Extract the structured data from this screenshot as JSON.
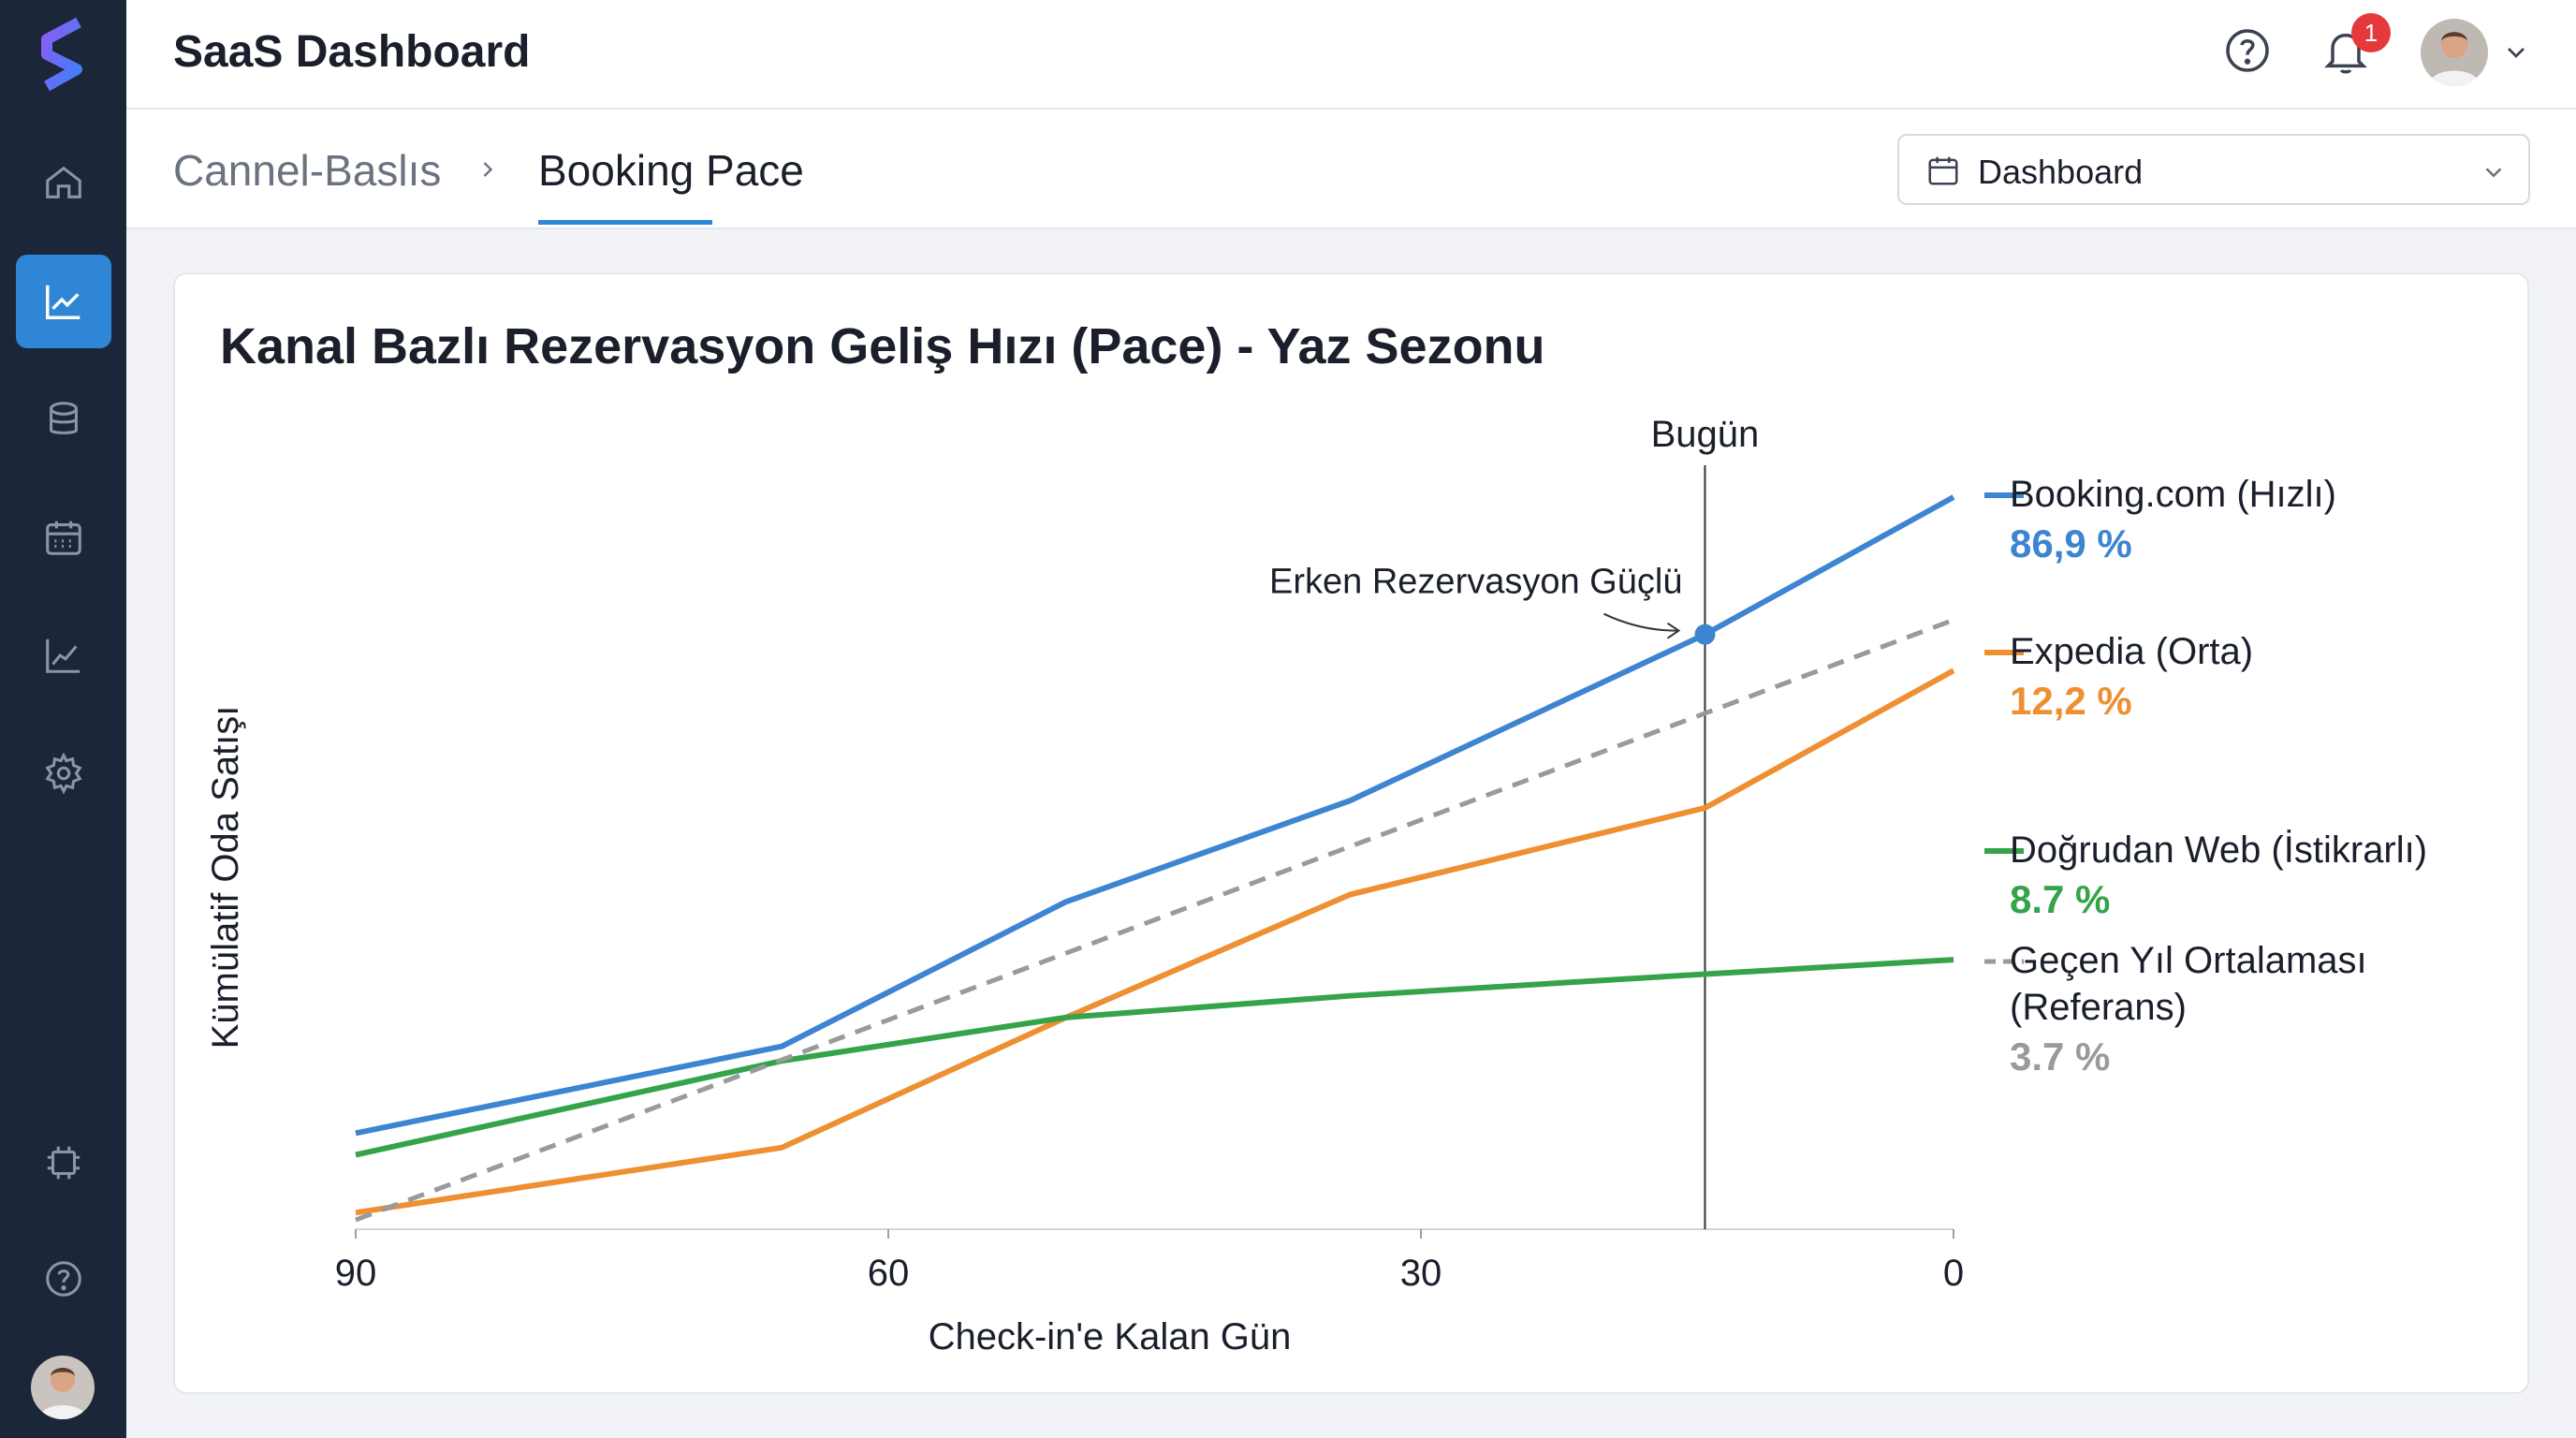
{
  "header": {
    "app_title": "SaaS Dashboard",
    "notification_count": "1"
  },
  "sidebar": {
    "items": [
      {
        "name": "home",
        "icon": "home-icon",
        "active": false
      },
      {
        "name": "analytics",
        "icon": "line-chart-icon",
        "active": true
      },
      {
        "name": "database",
        "icon": "database-icon",
        "active": false
      },
      {
        "name": "calendar",
        "icon": "calendar-icon",
        "active": false
      },
      {
        "name": "reports",
        "icon": "trend-icon",
        "active": false
      },
      {
        "name": "settings",
        "icon": "gear-icon",
        "active": false
      },
      {
        "name": "integrations",
        "icon": "chip-icon",
        "active": false
      },
      {
        "name": "help",
        "icon": "help-icon",
        "active": false
      }
    ]
  },
  "breadcrumb": {
    "parent": "Cannel-Baslıs",
    "current": "Booking Pace"
  },
  "dropdown": {
    "selected": "Dashboard"
  },
  "chart_data": {
    "type": "line",
    "title": "Kanal Bazlı Rezervasyon Geliş Hızı (Pace) - Yaz Sezonu",
    "xlabel": "Check-in'e Kalan Gün",
    "ylabel": "Kümülatif Oda Satışı",
    "x_ticks": [
      "90",
      "60",
      "30",
      "0"
    ],
    "xlim": [
      90,
      0
    ],
    "ylim": [
      0,
      100
    ],
    "today_label": "Bugün",
    "today_x": 14,
    "annotation": {
      "text": "Erken Rezervasyon Güçlü",
      "x": 14,
      "y": 81
    },
    "series": [
      {
        "name": "Booking.com (Hızlı)",
        "value_label": "86,9 %",
        "color": "#3d85d1",
        "dashed": false,
        "x": [
          90,
          66,
          50,
          34,
          14,
          0
        ],
        "y": [
          12,
          24,
          44,
          58,
          81,
          100
        ]
      },
      {
        "name": "Expedia (Orta)",
        "value_label": "12,2 %",
        "color": "#ee8f32",
        "dashed": false,
        "x": [
          90,
          66,
          50,
          34,
          14,
          0
        ],
        "y": [
          1,
          10,
          28,
          45,
          57,
          76
        ]
      },
      {
        "name": "Doğrudan Web (İstikrarlı)",
        "value_label": "8.7 %",
        "color": "#35a34a",
        "dashed": false,
        "x": [
          90,
          66,
          50,
          34,
          14,
          0
        ],
        "y": [
          9,
          22,
          28,
          31,
          34,
          36
        ]
      },
      {
        "name": "Geçen Yıl Ortalaması (Referans)",
        "value_label": "3.7 %",
        "color": "#9a9a9a",
        "dashed": true,
        "x": [
          90,
          0
        ],
        "y": [
          0,
          83
        ]
      }
    ]
  }
}
